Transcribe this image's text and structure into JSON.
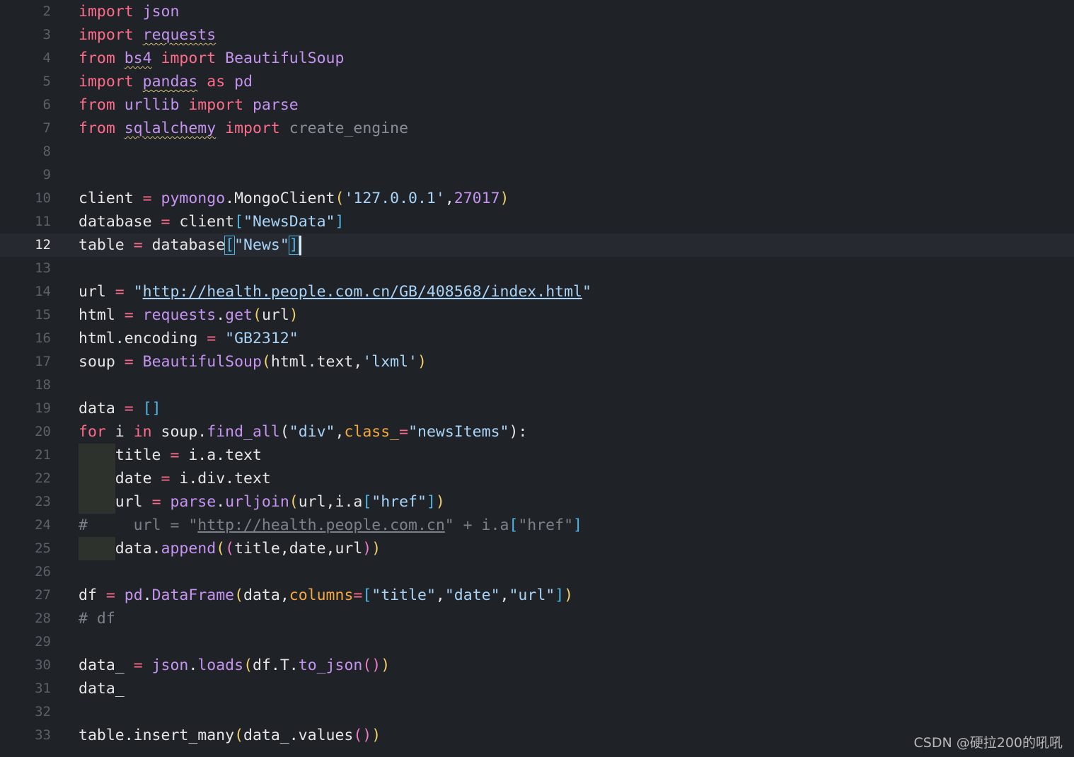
{
  "editor": {
    "current_line": 12,
    "lines": [
      {
        "n": "2",
        "tokens": [
          {
            "t": "import",
            "c": "kw"
          },
          {
            "t": " "
          },
          {
            "t": "json",
            "c": "purple"
          }
        ]
      },
      {
        "n": "3",
        "tokens": [
          {
            "t": "import",
            "c": "kw"
          },
          {
            "t": " "
          },
          {
            "t": "requests",
            "c": "purple",
            "sq": true
          }
        ]
      },
      {
        "n": "4",
        "tokens": [
          {
            "t": "from",
            "c": "kw"
          },
          {
            "t": " "
          },
          {
            "t": "bs4",
            "c": "purple",
            "sq": true
          },
          {
            "t": " "
          },
          {
            "t": "import",
            "c": "kw"
          },
          {
            "t": " "
          },
          {
            "t": "BeautifulSoup",
            "c": "purple"
          }
        ]
      },
      {
        "n": "5",
        "tokens": [
          {
            "t": "import",
            "c": "kw"
          },
          {
            "t": " "
          },
          {
            "t": "pandas",
            "c": "purple",
            "sq": true
          },
          {
            "t": " "
          },
          {
            "t": "as",
            "c": "kw"
          },
          {
            "t": " "
          },
          {
            "t": "pd",
            "c": "purple"
          }
        ]
      },
      {
        "n": "6",
        "tokens": [
          {
            "t": "from",
            "c": "kw"
          },
          {
            "t": " "
          },
          {
            "t": "urllib",
            "c": "purple"
          },
          {
            "t": " "
          },
          {
            "t": "import",
            "c": "kw"
          },
          {
            "t": " "
          },
          {
            "t": "parse",
            "c": "purple"
          }
        ]
      },
      {
        "n": "7",
        "tokens": [
          {
            "t": "from",
            "c": "kw"
          },
          {
            "t": " "
          },
          {
            "t": "sqlalchemy",
            "c": "purple",
            "sq": true
          },
          {
            "t": " "
          },
          {
            "t": "import",
            "c": "kw"
          },
          {
            "t": " "
          },
          {
            "t": "create_engine",
            "c": "dim"
          }
        ]
      },
      {
        "n": "8",
        "tokens": []
      },
      {
        "n": "9",
        "tokens": []
      },
      {
        "n": "10",
        "tokens": [
          {
            "t": "client"
          },
          {
            "t": " "
          },
          {
            "t": "=",
            "c": "op"
          },
          {
            "t": " "
          },
          {
            "t": "pymongo",
            "c": "purple"
          },
          {
            "t": ".MongoClient"
          },
          {
            "t": "(",
            "c": "p1"
          },
          {
            "t": "'127.0.0.1'",
            "c": "str"
          },
          {
            "t": ","
          },
          {
            "t": "27017",
            "c": "num"
          },
          {
            "t": ")",
            "c": "p1"
          }
        ]
      },
      {
        "n": "11",
        "tokens": [
          {
            "t": "database"
          },
          {
            "t": " "
          },
          {
            "t": "=",
            "c": "op"
          },
          {
            "t": " "
          },
          {
            "t": "client"
          },
          {
            "t": "[",
            "c": "p3"
          },
          {
            "t": "\"NewsData\"",
            "c": "str"
          },
          {
            "t": "]",
            "c": "p3"
          }
        ]
      },
      {
        "n": "12",
        "tokens": [
          {
            "t": "table"
          },
          {
            "t": " "
          },
          {
            "t": "=",
            "c": "op"
          },
          {
            "t": " "
          },
          {
            "t": "database"
          },
          {
            "t": "[",
            "c": "bmatch"
          },
          {
            "t": "\"News\"",
            "c": "str"
          },
          {
            "t": "]",
            "c": "bmatch"
          }
        ],
        "cursor": true
      },
      {
        "n": "13",
        "tokens": []
      },
      {
        "n": "14",
        "tokens": [
          {
            "t": "url"
          },
          {
            "t": " "
          },
          {
            "t": "=",
            "c": "op"
          },
          {
            "t": " "
          },
          {
            "t": "\"",
            "c": "str"
          },
          {
            "t": "http://health.people.com.cn/GB/408568/index.html",
            "c": "strlink"
          },
          {
            "t": "\"",
            "c": "str"
          }
        ]
      },
      {
        "n": "15",
        "tokens": [
          {
            "t": "html"
          },
          {
            "t": " "
          },
          {
            "t": "=",
            "c": "op"
          },
          {
            "t": " "
          },
          {
            "t": "requests",
            "c": "purple"
          },
          {
            "t": "."
          },
          {
            "t": "get",
            "c": "purple"
          },
          {
            "t": "(",
            "c": "p1"
          },
          {
            "t": "url"
          },
          {
            "t": ")",
            "c": "p1"
          }
        ]
      },
      {
        "n": "16",
        "tokens": [
          {
            "t": "html.encoding"
          },
          {
            "t": " "
          },
          {
            "t": "=",
            "c": "op"
          },
          {
            "t": " "
          },
          {
            "t": "\"GB2312\"",
            "c": "str"
          }
        ]
      },
      {
        "n": "17",
        "tokens": [
          {
            "t": "soup"
          },
          {
            "t": " "
          },
          {
            "t": "=",
            "c": "op"
          },
          {
            "t": " "
          },
          {
            "t": "BeautifulSoup",
            "c": "purple"
          },
          {
            "t": "(",
            "c": "p1"
          },
          {
            "t": "html.text,"
          },
          {
            "t": "'lxml'",
            "c": "str"
          },
          {
            "t": ")",
            "c": "p1"
          }
        ]
      },
      {
        "n": "18",
        "tokens": []
      },
      {
        "n": "19",
        "tokens": [
          {
            "t": "data"
          },
          {
            "t": " "
          },
          {
            "t": "=",
            "c": "op"
          },
          {
            "t": " "
          },
          {
            "t": "[]",
            "c": "p3"
          }
        ]
      },
      {
        "n": "20",
        "tokens": [
          {
            "t": "for",
            "c": "kw"
          },
          {
            "t": " i "
          },
          {
            "t": "in",
            "c": "kw"
          },
          {
            "t": " soup."
          },
          {
            "t": "find_all",
            "c": "purple"
          },
          {
            "t": "("
          },
          {
            "t": "\"div\"",
            "c": "str"
          },
          {
            "t": ","
          },
          {
            "t": "class_",
            "c": "param"
          },
          {
            "t": "=",
            "c": "op"
          },
          {
            "t": "\"newsItems\"",
            "c": "str"
          },
          {
            "t": "):"
          }
        ]
      },
      {
        "n": "21",
        "indent": true,
        "tokens": [
          {
            "t": "    title"
          },
          {
            "t": " "
          },
          {
            "t": "=",
            "c": "op"
          },
          {
            "t": " i.a.text"
          }
        ]
      },
      {
        "n": "22",
        "indent": true,
        "tokens": [
          {
            "t": "    date"
          },
          {
            "t": " "
          },
          {
            "t": "=",
            "c": "op"
          },
          {
            "t": " i.div.text"
          }
        ]
      },
      {
        "n": "23",
        "indent": true,
        "tokens": [
          {
            "t": "    url"
          },
          {
            "t": " "
          },
          {
            "t": "=",
            "c": "op"
          },
          {
            "t": " "
          },
          {
            "t": "parse",
            "c": "purple"
          },
          {
            "t": "."
          },
          {
            "t": "urljoin",
            "c": "purple"
          },
          {
            "t": "(",
            "c": "p1"
          },
          {
            "t": "url,i.a"
          },
          {
            "t": "[",
            "c": "p3"
          },
          {
            "t": "\"href\"",
            "c": "str"
          },
          {
            "t": "]",
            "c": "p3"
          },
          {
            "t": ")",
            "c": "p1"
          }
        ]
      },
      {
        "n": "24",
        "tokens": [
          {
            "t": "#     url = \"",
            "c": "comment"
          },
          {
            "t": "http://health.people.com.cn",
            "c": "commentlink"
          },
          {
            "t": "\" + i.a",
            "c": "comment"
          },
          {
            "t": "[",
            "c": "p3"
          },
          {
            "t": "\"href\"",
            "c": "comment"
          },
          {
            "t": "]",
            "c": "p3"
          }
        ]
      },
      {
        "n": "25",
        "indent": true,
        "tokens": [
          {
            "t": "    data."
          },
          {
            "t": "append",
            "c": "purple"
          },
          {
            "t": "(",
            "c": "p1"
          },
          {
            "t": "(",
            "c": "p2"
          },
          {
            "t": "title,date,url"
          },
          {
            "t": ")",
            "c": "p2"
          },
          {
            "t": ")",
            "c": "p1"
          }
        ]
      },
      {
        "n": "26",
        "tokens": []
      },
      {
        "n": "27",
        "tokens": [
          {
            "t": "df"
          },
          {
            "t": " "
          },
          {
            "t": "=",
            "c": "op"
          },
          {
            "t": " "
          },
          {
            "t": "pd",
            "c": "purple"
          },
          {
            "t": "."
          },
          {
            "t": "DataFrame",
            "c": "purple"
          },
          {
            "t": "(",
            "c": "p1"
          },
          {
            "t": "data,"
          },
          {
            "t": "columns",
            "c": "param"
          },
          {
            "t": "=",
            "c": "op"
          },
          {
            "t": "[",
            "c": "p3"
          },
          {
            "t": "\"title\"",
            "c": "str"
          },
          {
            "t": ","
          },
          {
            "t": "\"date\"",
            "c": "str"
          },
          {
            "t": ","
          },
          {
            "t": "\"url\"",
            "c": "str"
          },
          {
            "t": "]",
            "c": "p3"
          },
          {
            "t": ")",
            "c": "p1"
          }
        ]
      },
      {
        "n": "28",
        "tokens": [
          {
            "t": "# df",
            "c": "comment"
          }
        ]
      },
      {
        "n": "29",
        "tokens": []
      },
      {
        "n": "30",
        "tokens": [
          {
            "t": "data_"
          },
          {
            "t": " "
          },
          {
            "t": "=",
            "c": "op"
          },
          {
            "t": " "
          },
          {
            "t": "json",
            "c": "purple"
          },
          {
            "t": "."
          },
          {
            "t": "loads",
            "c": "purple"
          },
          {
            "t": "(",
            "c": "p1"
          },
          {
            "t": "df.T."
          },
          {
            "t": "to_json",
            "c": "purple"
          },
          {
            "t": "()",
            "c": "p2"
          },
          {
            "t": ")",
            "c": "p1"
          }
        ]
      },
      {
        "n": "31",
        "tokens": [
          {
            "t": "data_"
          }
        ]
      },
      {
        "n": "32",
        "tokens": []
      },
      {
        "n": "33",
        "tokens": [
          {
            "t": "table.insert_many"
          },
          {
            "t": "(",
            "c": "p1"
          },
          {
            "t": "data_.values"
          },
          {
            "t": "()",
            "c": "p2"
          },
          {
            "t": ")",
            "c": "p1"
          }
        ]
      }
    ]
  },
  "watermark": "CSDN @硬拉200的吼吼",
  "colors": {
    "background": "#1f2227",
    "current_line": "#262a30",
    "keyword": "#ff6b8a",
    "identifier": "#c594f0",
    "string": "#a9d4f7",
    "paren": "#f2d16b",
    "bracket": "#4fb6e6",
    "param": "#f5a93b",
    "comment": "#7c8088"
  }
}
